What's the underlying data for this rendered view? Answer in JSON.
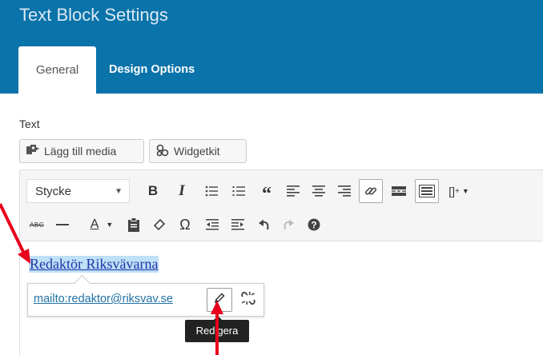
{
  "window": {
    "title": "Text Block Settings"
  },
  "tabs": [
    {
      "label": "General"
    },
    {
      "label": "Design Options"
    }
  ],
  "section": {
    "label": "Text"
  },
  "buttons": {
    "add_media": "Lägg till media",
    "widgetkit": "Widgetkit"
  },
  "toolbar": {
    "format_select": "Stycke",
    "row1_icons": [
      "bold-icon",
      "italic-icon",
      "bullet-list-icon",
      "numbered-list-icon",
      "blockquote-icon",
      "align-left-icon",
      "align-center-icon",
      "align-right-icon",
      "link-icon",
      "read-more-icon",
      "toolbar-toggle-icon",
      "shortcode-icon"
    ],
    "row2_icons": [
      "strikethrough-icon",
      "horizontal-line-icon",
      "text-color-icon",
      "paste-as-text-icon",
      "clear-formatting-icon",
      "special-character-icon",
      "outdent-icon",
      "indent-icon",
      "undo-icon",
      "redo-icon",
      "help-icon"
    ]
  },
  "content": {
    "link_text": "Redaktör Riksvävarna"
  },
  "link_popup": {
    "url": "mailto:redaktor@riksvav.se"
  },
  "tooltip": {
    "text": "Redigera"
  },
  "colors": {
    "header_bg": "#0a73aa",
    "arrow": "#e8001c",
    "link": "#2233aa",
    "highlight": "#bfe0f6"
  }
}
